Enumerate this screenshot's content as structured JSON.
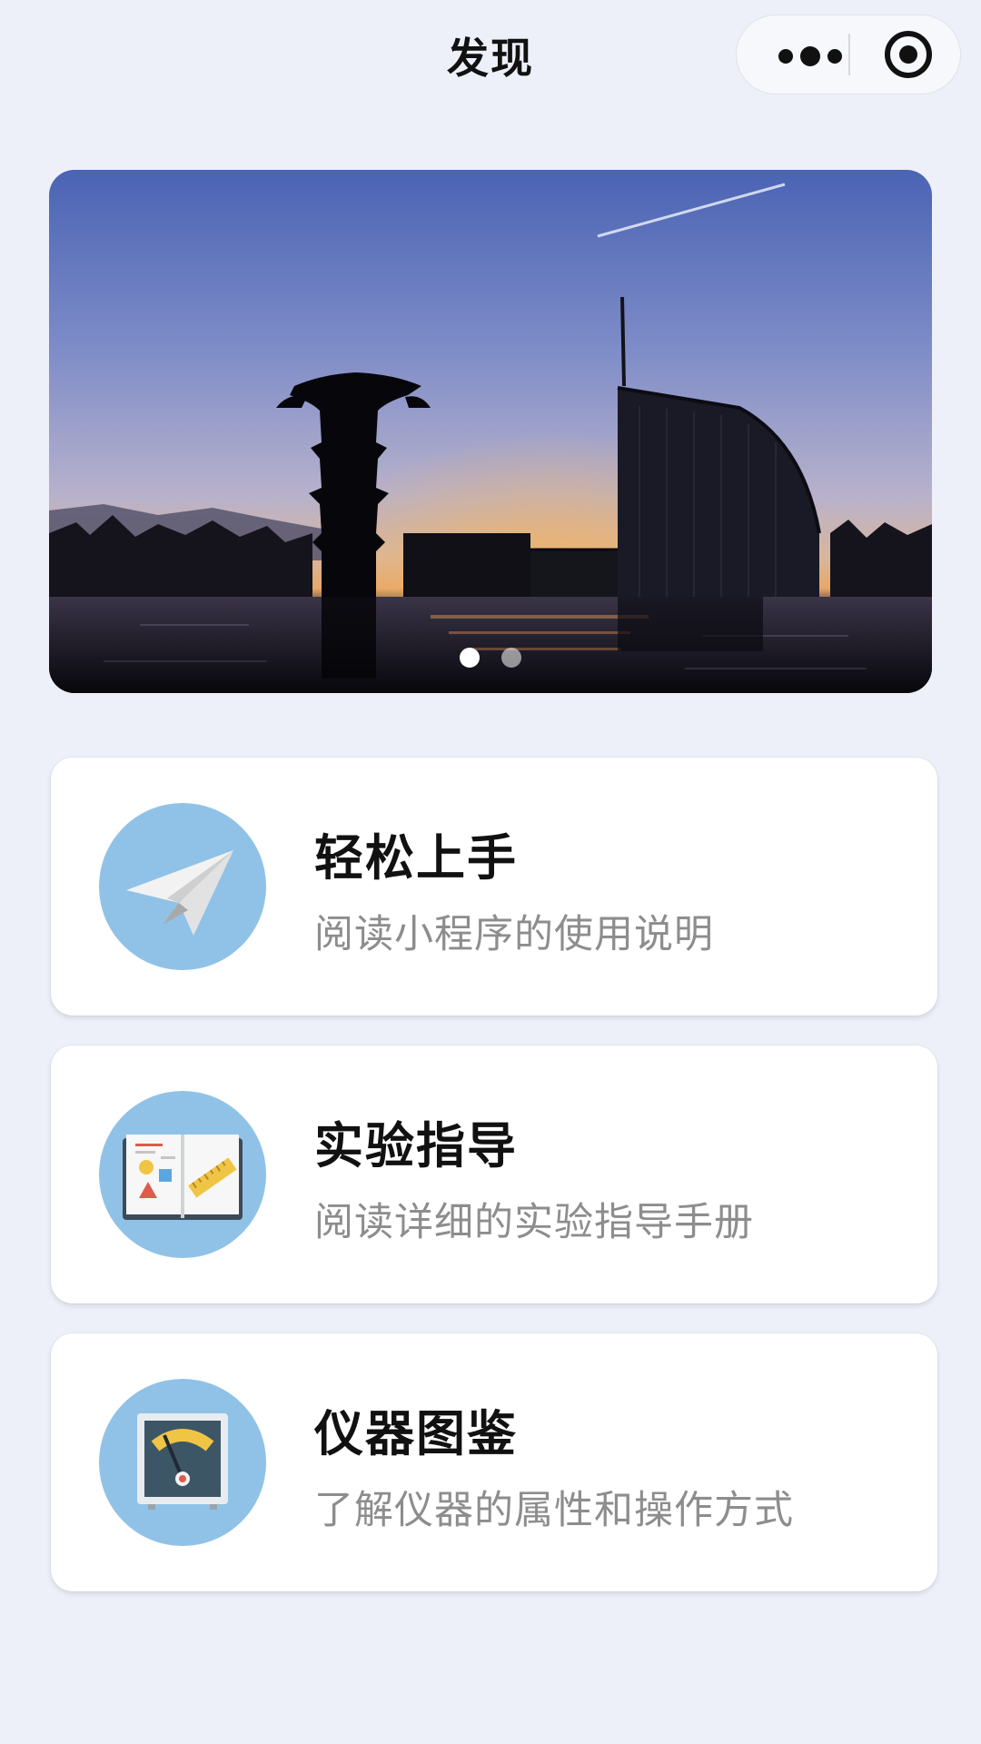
{
  "header": {
    "title": "发现"
  },
  "capsule": {
    "more_icon": "more-dots-icon",
    "close_icon": "target-icon"
  },
  "banner": {
    "image": "campus-sunset-silhouette",
    "slide_count": 2,
    "active_slide": 1
  },
  "cards": [
    {
      "title": "轻松上手",
      "subtitle": "阅读小程序的使用说明",
      "icon": "paper-plane-icon"
    },
    {
      "title": "实验指导",
      "subtitle": "阅读详细的实验指导手册",
      "icon": "open-book-icon"
    },
    {
      "title": "仪器图鉴",
      "subtitle": "了解仪器的属性和操作方式",
      "icon": "meter-gauge-icon"
    }
  ],
  "colors": {
    "background": "#edf0f9",
    "icon_circle": "#90c2e7",
    "subtitle_text": "#8d8d8d"
  }
}
